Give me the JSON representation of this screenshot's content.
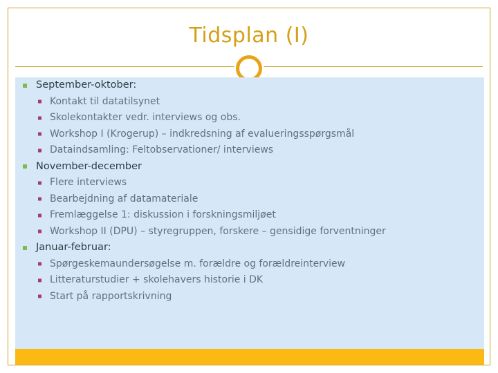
{
  "slide": {
    "title": "Tidsplan (I)",
    "accent_gold": "#c9a227",
    "title_color": "#d4a017",
    "ring_color": "#e8a317",
    "panel_color": "#d6e8f7",
    "bottom_bar_color": "#fdb913",
    "level1_bullet_color": "#7fba4c",
    "level2_bullet_color": "#9e3f6e",
    "level1_text_color": "#2e3b44",
    "level2_text_color": "#5d7186"
  },
  "content": {
    "sections": [
      {
        "heading": "September-oktober:",
        "items": [
          "Kontakt til datatilsynet",
          "Skolekontakter vedr. interviews og obs.",
          "Workshop I (Krogerup) – indkredsning af evalueringsspørgsmål",
          "Dataindsamling: Feltobservationer/ interviews"
        ]
      },
      {
        "heading": "November-december",
        "items": [
          "Flere interviews",
          "Bearbejdning af datamateriale",
          "Fremlæggelse 1: diskussion i forskningsmiljøet",
          "Workshop II (DPU) – styregruppen, forskere – gensidige forventninger"
        ]
      },
      {
        "heading": "Januar-februar:",
        "items": [
          "Spørgeskemaundersøgelse m. forældre og forældreinterview",
          "Litteraturstudier + skolehavers historie i DK",
          "Start på rapportskrivning"
        ]
      }
    ]
  }
}
